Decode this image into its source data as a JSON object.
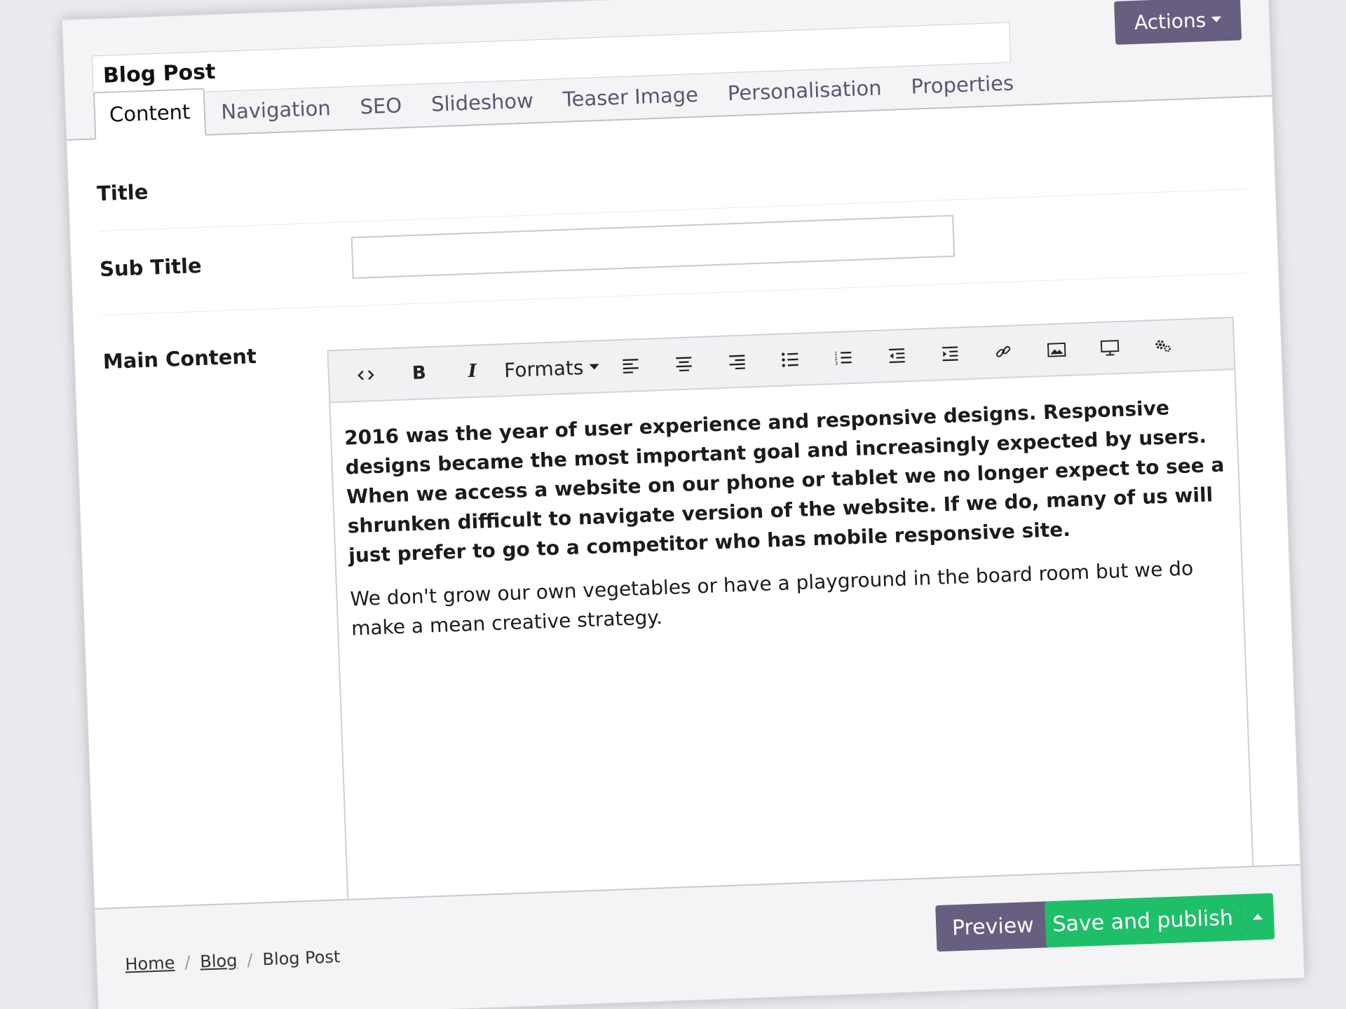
{
  "header": {
    "title_value": "Blog Post",
    "actions_label": "Actions",
    "tabs": [
      {
        "label": "Content",
        "active": true
      },
      {
        "label": "Navigation"
      },
      {
        "label": "SEO"
      },
      {
        "label": "Slideshow"
      },
      {
        "label": "Teaser Image"
      },
      {
        "label": "Personalisation"
      },
      {
        "label": "Properties"
      }
    ]
  },
  "form": {
    "title_label": "Title",
    "subtitle_label": "Sub Title",
    "subtitle_value": "",
    "main_content_label": "Main Content"
  },
  "editor": {
    "toolbar": {
      "code_icon": "code-icon",
      "bold_label": "B",
      "italic_label": "I",
      "formats_label": "Formats",
      "icons": [
        "align-left-icon",
        "align-center-icon",
        "align-right-icon",
        "bullet-list-icon",
        "numbered-list-icon",
        "outdent-icon",
        "indent-icon",
        "link-icon",
        "image-icon",
        "media-icon",
        "macro-icon"
      ]
    },
    "paragraph_bold": "2016 was the year of user experience and responsive designs. Responsive designs became the most important goal and increasingly expected by users. When we access a website on our phone or tablet we no longer expect to see a shrunken difficult to navigate version of the website. If we do, many of us will just prefer to go to a competitor who has mobile responsive site.",
    "paragraph_normal": "We don't grow our own vegetables or have a playground in the board room but we do make a mean creative strategy."
  },
  "footer": {
    "preview_label": "Preview",
    "save_label": "Save and publish",
    "breadcrumb": [
      {
        "label": "Home",
        "link": true
      },
      {
        "label": "Blog",
        "link": true
      },
      {
        "label": "Blog Post",
        "link": false
      }
    ]
  },
  "colors": {
    "primary": "#675e80",
    "success": "#1fbf6a"
  }
}
